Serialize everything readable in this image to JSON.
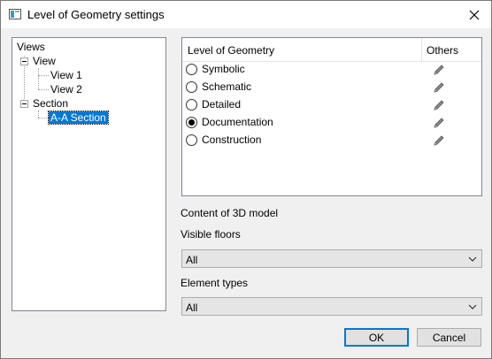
{
  "window": {
    "title": "Level of Geometry settings",
    "icon": "dialog-icon",
    "close_icon": "close-icon"
  },
  "tree": {
    "root_label": "Views",
    "groups": [
      {
        "label": "View",
        "expanded": true,
        "children": [
          "View 1",
          "View 2"
        ]
      },
      {
        "label": "Section",
        "expanded": true,
        "children": [
          "A-A Section"
        ]
      }
    ],
    "selected": "A-A Section"
  },
  "lod_table": {
    "header_level": "Level of Geometry",
    "header_others": "Others",
    "rows": [
      {
        "label": "Symbolic",
        "checked": false,
        "icon": "pencil-icon"
      },
      {
        "label": "Schematic",
        "checked": false,
        "icon": "pencil-icon"
      },
      {
        "label": "Detailed",
        "checked": false,
        "icon": "pencil-icon"
      },
      {
        "label": "Documentation",
        "checked": true,
        "icon": "pencil-icon"
      },
      {
        "label": "Construction",
        "checked": false,
        "icon": "pencil-icon"
      }
    ]
  },
  "content_3d": {
    "heading": "Content of 3D model",
    "visible_floors_label": "Visible floors",
    "visible_floors_value": "All",
    "element_types_label": "Element types",
    "element_types_value": "All"
  },
  "buttons": {
    "ok": "OK",
    "cancel": "Cancel"
  },
  "colors": {
    "selection": "#0078d7",
    "dialog_bg": "#f0f0f0",
    "default_button_border": "#0078d7"
  }
}
